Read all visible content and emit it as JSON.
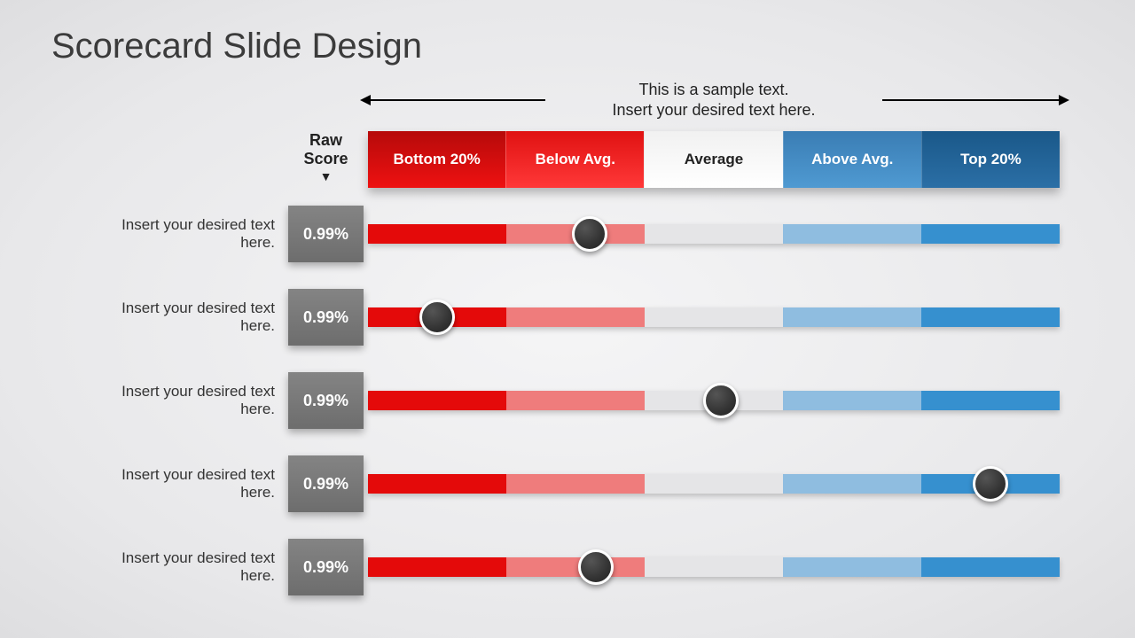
{
  "title": "Scorecard Slide Design",
  "subtitle_line1": "This is a sample text.",
  "subtitle_line2": "Insert your desired text here.",
  "raw_score_header": "Raw Score",
  "columns": [
    {
      "label": "Bottom 20%"
    },
    {
      "label": "Below Avg."
    },
    {
      "label": "Average"
    },
    {
      "label": "Above Avg."
    },
    {
      "label": "Top 20%"
    }
  ],
  "rows": [
    {
      "label": "Insert your desired text here.",
      "score": "0.99%",
      "marker_pct": 32
    },
    {
      "label": "Insert your desired text here.",
      "score": "0.99%",
      "marker_pct": 10
    },
    {
      "label": "Insert your desired text here.",
      "score": "0.99%",
      "marker_pct": 51
    },
    {
      "label": "Insert your desired text here.",
      "score": "0.99%",
      "marker_pct": 90
    },
    {
      "label": "Insert your desired text here.",
      "score": "0.99%",
      "marker_pct": 33
    }
  ],
  "chart_data": {
    "type": "table",
    "title": "Scorecard Slide Design",
    "columns": [
      "Bottom 20%",
      "Below Avg.",
      "Average",
      "Above Avg.",
      "Top 20%"
    ],
    "series": [
      {
        "name": "Insert your desired text here.",
        "raw_score": "0.99%",
        "position_pct": 32
      },
      {
        "name": "Insert your desired text here.",
        "raw_score": "0.99%",
        "position_pct": 10
      },
      {
        "name": "Insert your desired text here.",
        "raw_score": "0.99%",
        "position_pct": 51
      },
      {
        "name": "Insert your desired text here.",
        "raw_score": "0.99%",
        "position_pct": 90
      },
      {
        "name": "Insert your desired text here.",
        "raw_score": "0.99%",
        "position_pct": 33
      }
    ],
    "xlabel": "",
    "ylabel": "",
    "xlim": [
      0,
      100
    ]
  }
}
